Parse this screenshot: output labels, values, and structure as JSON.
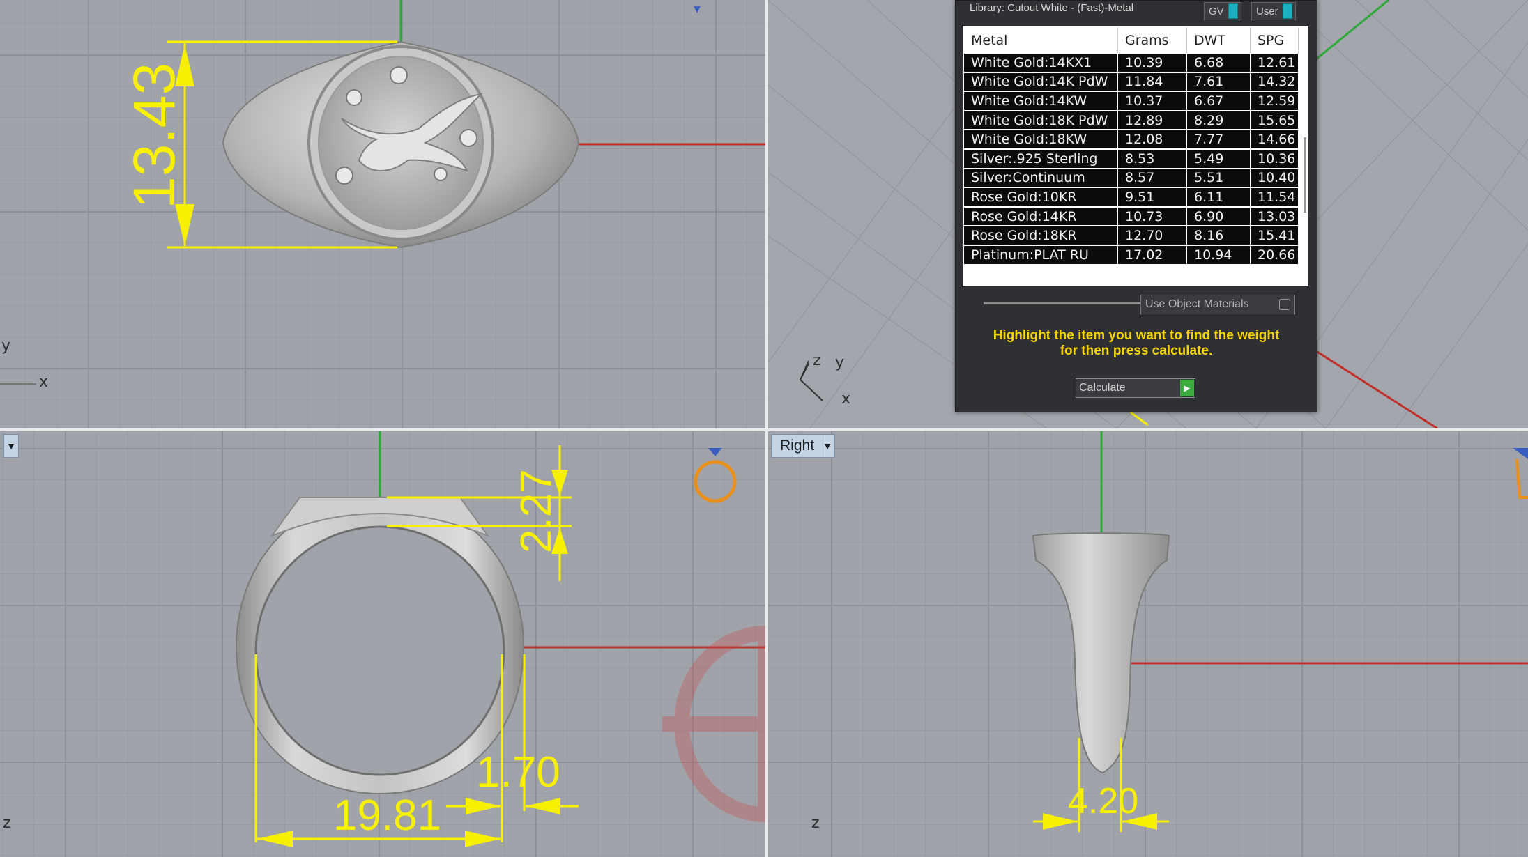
{
  "viewports": {
    "top": {
      "axis_x": "x",
      "axis_y": "y"
    },
    "perspective": {
      "axis_x": "x",
      "axis_y": "y",
      "axis_z": "z"
    },
    "front": {
      "axis_z": "z"
    },
    "right": {
      "label": "Right",
      "axis_z": "z"
    }
  },
  "dimensions": {
    "top_height": "13.43",
    "front_head": "2.27",
    "front_diameter": "19.81",
    "front_shank": "1.70",
    "right_width": "4.20"
  },
  "colors": {
    "dimension": "#f7f000",
    "x_axis": "#c0302a",
    "y_axis": "#2fa83a",
    "panel_bg": "#2f3033",
    "hint_text": "#f7d400"
  },
  "panel": {
    "title": "Library: Cutout White - (Fast)-Metal",
    "toggle_gv": "GV",
    "toggle_user": "User",
    "columns": [
      "Metal",
      "Grams",
      "DWT",
      "SPG"
    ],
    "rows": [
      [
        "White Gold:14KX1",
        "10.39",
        "6.68",
        "12.61"
      ],
      [
        "White Gold:14K PdW",
        "11.84",
        "7.61",
        "14.32"
      ],
      [
        "White Gold:14KW",
        "10.37",
        "6.67",
        "12.59"
      ],
      [
        "White Gold:18K PdW",
        "12.89",
        "8.29",
        "15.65"
      ],
      [
        "White Gold:18KW",
        "12.08",
        "7.77",
        "14.66"
      ],
      [
        "Silver:.925 Sterling",
        "8.53",
        "5.49",
        "10.36"
      ],
      [
        "Silver:Continuum",
        "8.57",
        "5.51",
        "10.40"
      ],
      [
        "Rose Gold:10KR",
        "9.51",
        "6.11",
        "11.54"
      ],
      [
        "Rose Gold:14KR",
        "10.73",
        "6.90",
        "13.03"
      ],
      [
        "Rose Gold:18KR",
        "12.70",
        "8.16",
        "15.41"
      ],
      [
        "Platinum:PLAT RU",
        "17.02",
        "10.94",
        "20.66"
      ]
    ],
    "use_object_materials": "Use Object Materials",
    "hint_line1": "Highlight the item you want to find the weight",
    "hint_line2": "for then press calculate.",
    "calculate": "Calculate"
  }
}
